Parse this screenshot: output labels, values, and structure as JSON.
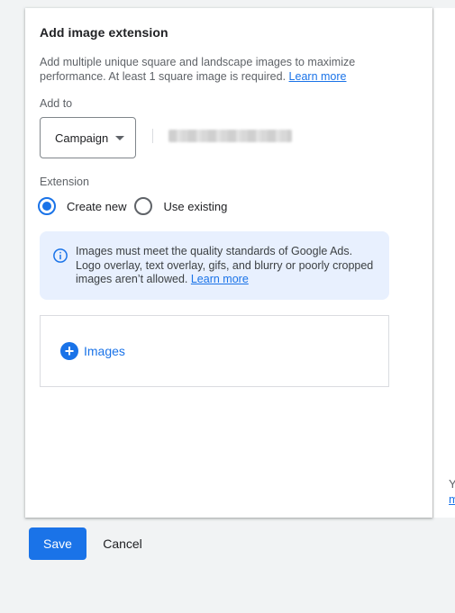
{
  "side_panel": {
    "text_1": "Y",
    "text_2": "m"
  },
  "dialog": {
    "title": "Add image extension",
    "description": "Add multiple unique square and landscape images to maximize performance. At least 1 square image is required.",
    "description_link": "Learn more",
    "add_to": {
      "label": "Add to",
      "selected": "Campaign"
    },
    "extension": {
      "label": "Extension",
      "options": [
        {
          "label": "Create new",
          "checked": true
        },
        {
          "label": "Use existing",
          "checked": false
        }
      ]
    },
    "info": {
      "text": "Images must meet the quality standards of Google Ads. Logo overlay, text overlay, gifs, and blurry or poorly cropped images aren’t allowed.",
      "link": "Learn more"
    },
    "images": {
      "add_label": "Images"
    }
  },
  "footer": {
    "save_label": "Save",
    "cancel_label": "Cancel"
  },
  "colors": {
    "accent": "#1a73e8",
    "info_bg": "#e8f0fe",
    "page_bg": "#f1f3f4"
  },
  "icons": {
    "dropdown": "caret-down-icon",
    "info": "info-icon",
    "add": "plus-circle-icon"
  }
}
